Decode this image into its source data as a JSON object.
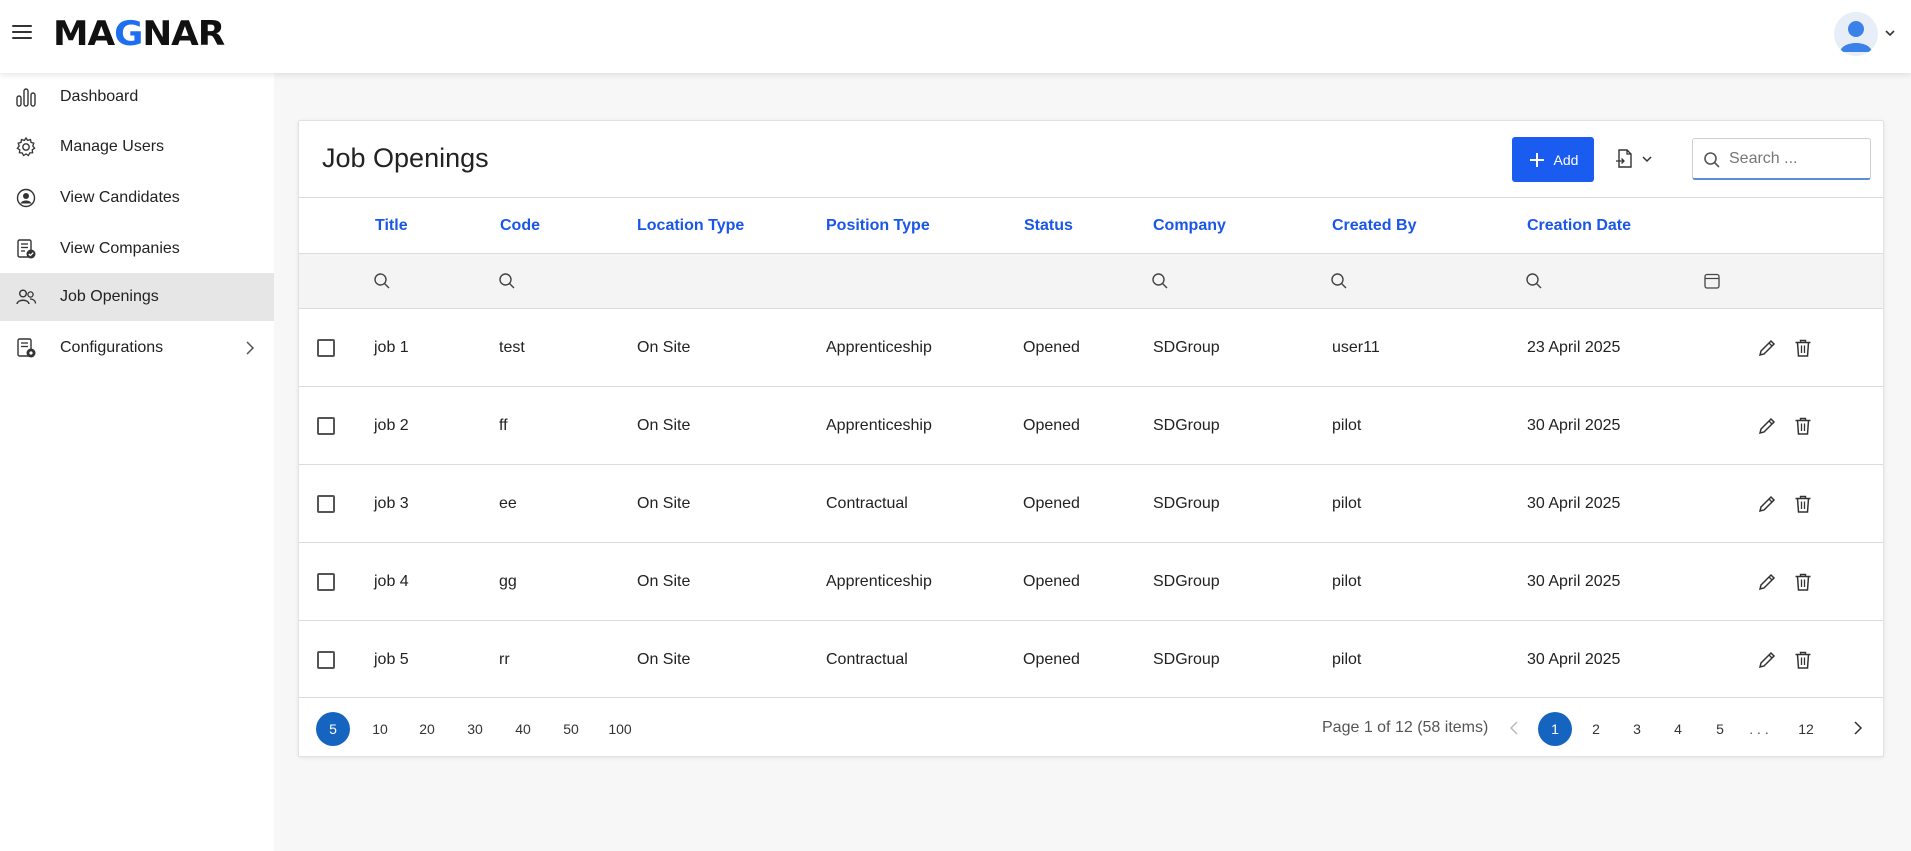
{
  "app": {
    "logo_pre": "MA",
    "logo_accent": "G",
    "logo_post": "NAR"
  },
  "sidebar": {
    "items": [
      {
        "label": "Dashboard"
      },
      {
        "label": "Manage Users"
      },
      {
        "label": "View Candidates"
      },
      {
        "label": "View Companies"
      },
      {
        "label": "Job Openings"
      },
      {
        "label": "Configurations"
      }
    ]
  },
  "page": {
    "title": "Job Openings",
    "add_label": "Add",
    "search_placeholder": "Search ..."
  },
  "table": {
    "headers": [
      "Title",
      "Code",
      "Location Type",
      "Position Type",
      "Status",
      "Company",
      "Created By",
      "Creation Date"
    ],
    "rows": [
      [
        "job 1",
        "test",
        "On Site",
        "Apprenticeship",
        "Opened",
        "SDGroup",
        "user11",
        "23 April 2025"
      ],
      [
        "job 2",
        "ff",
        "On Site",
        "Apprenticeship",
        "Opened",
        "SDGroup",
        "pilot",
        "30 April 2025"
      ],
      [
        "job 3",
        "ee",
        "On Site",
        "Contractual",
        "Opened",
        "SDGroup",
        "pilot",
        "30 April 2025"
      ],
      [
        "job 4",
        "gg",
        "On Site",
        "Apprenticeship",
        "Opened",
        "SDGroup",
        "pilot",
        "30 April 2025"
      ],
      [
        "job 5",
        "rr",
        "On Site",
        "Contractual",
        "Opened",
        "SDGroup",
        "pilot",
        "30 April 2025"
      ]
    ]
  },
  "pagination": {
    "sizes": [
      "5",
      "10",
      "20",
      "30",
      "40",
      "50",
      "100"
    ],
    "selected_size": "5",
    "info": "Page 1 of 12 (58 items)",
    "pages": [
      "1",
      "2",
      "3",
      "4",
      "5",
      ". . .",
      "12"
    ],
    "current_page": "1"
  },
  "colors": {
    "accent": "#1a5cf0",
    "header_text": "#1a56e8",
    "selected_page": "#1565c0"
  }
}
